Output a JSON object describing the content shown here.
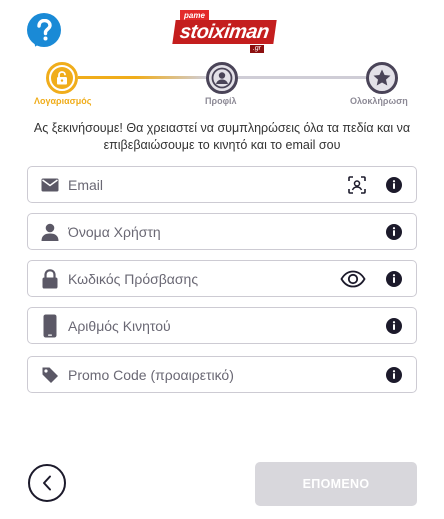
{
  "header": {
    "help_icon": "question-mark-icon",
    "logo": {
      "top_tag": "pame",
      "wordmark": "stoiximan",
      "suffix": ".gr"
    }
  },
  "stepper": {
    "steps": [
      {
        "label": "Λογαριασμός",
        "icon": "lock-icon",
        "state": "active"
      },
      {
        "label": "Προφίλ",
        "icon": "user-icon",
        "state": "inactive"
      },
      {
        "label": "Ολοκλήρωση",
        "icon": "star-icon",
        "state": "inactive"
      }
    ],
    "active_color": "#f0ad1b"
  },
  "intro_text": "Ας ξεκινήσουμε! Θα χρειαστεί να συμπληρώσεις όλα τα πεδία και να επιβεβαιώσουμε το κινητό και το email σου",
  "form": {
    "email": {
      "placeholder": "Email",
      "value": "",
      "icon": "envelope-icon",
      "extra_icon": "face-scan-icon"
    },
    "username": {
      "placeholder": "Όνομα Χρήστη",
      "value": "",
      "icon": "user-icon"
    },
    "password": {
      "placeholder": "Κωδικός Πρόσβασης",
      "value": "",
      "icon": "lock-icon",
      "extra_icon": "eye-icon"
    },
    "phone": {
      "placeholder": "Αριθμός Κινητού",
      "value": "",
      "icon": "phone-icon"
    },
    "promo": {
      "placeholder": "Promo Code (προαιρετικό)",
      "value": "",
      "icon": "tag-icon"
    }
  },
  "footer": {
    "back_icon": "chevron-left-icon",
    "next_label": "ΕΠΟΜΕΝΟ"
  }
}
